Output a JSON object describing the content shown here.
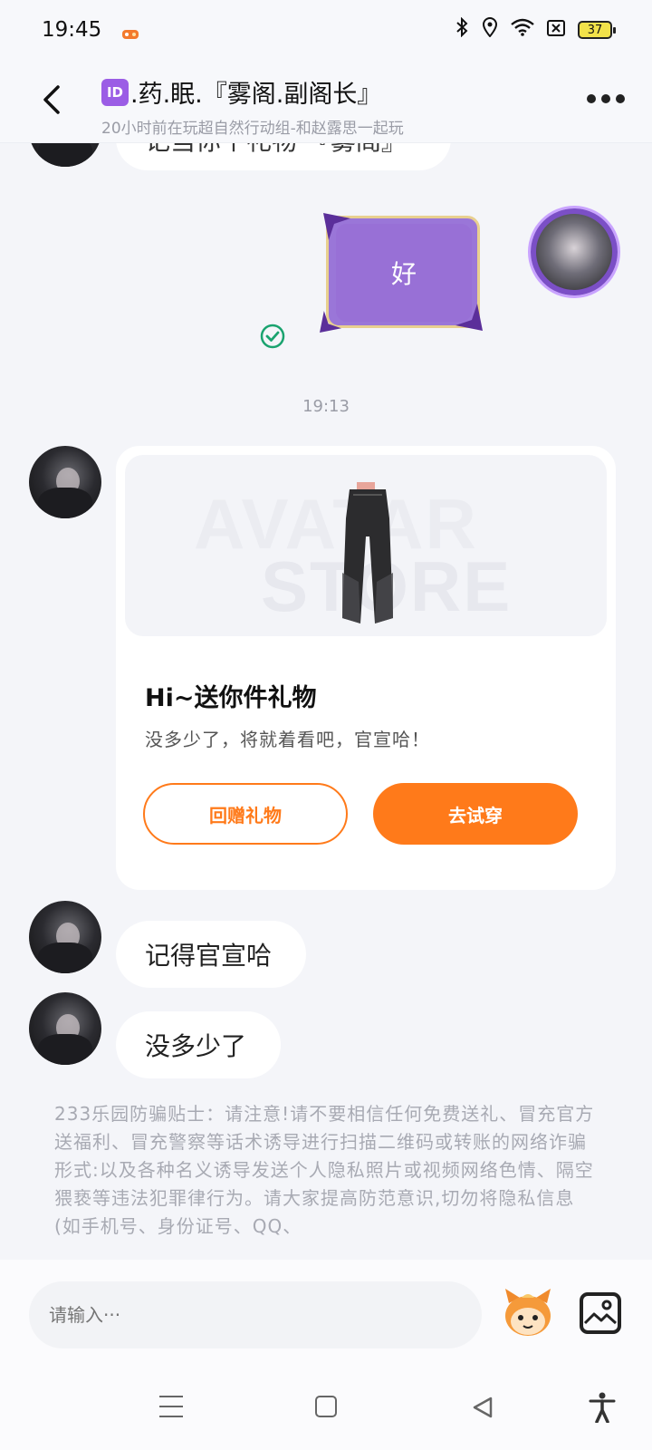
{
  "status_bar": {
    "time": "19:45",
    "battery": "37"
  },
  "header": {
    "title_badge": "ID",
    "title": ".药.眠.『雾阁.副阁长』",
    "subtitle": "20小时前在玩超自然行动组-和赵露思一起玩"
  },
  "chat": {
    "partial_message": "记当你个礼物 『雾阁』",
    "sticker_text": "好",
    "timestamp": "19:13",
    "gift_card": {
      "watermark_line1": "AVATAR",
      "watermark_line2": "STORE",
      "title": "Hi~送你件礼物",
      "description": "没多少了，将就着看吧，官宣哈！",
      "return_button": "回赠礼物",
      "try_button": "去试穿"
    },
    "messages": [
      {
        "text": "记得官宣哈"
      },
      {
        "text": "没多少了"
      }
    ],
    "tips": "233乐园防骗贴士：请注意!请不要相信任何免费送礼、冒充官方送福利、冒充警察等话术诱导进行扫描二维码或转账的网络诈骗形式:以及各种名义诱导发送个人隐私照片或视频网络色情、隔空猥亵等违法犯罪律行为。请大家提高防范意识,切勿将隐私信息(如手机号、身份证号、QQ、"
  },
  "input": {
    "placeholder": "请输入···"
  },
  "colors": {
    "accent": "#ff7a1a",
    "sticker": "#9870d6",
    "sent_check": "#1aa36f"
  }
}
